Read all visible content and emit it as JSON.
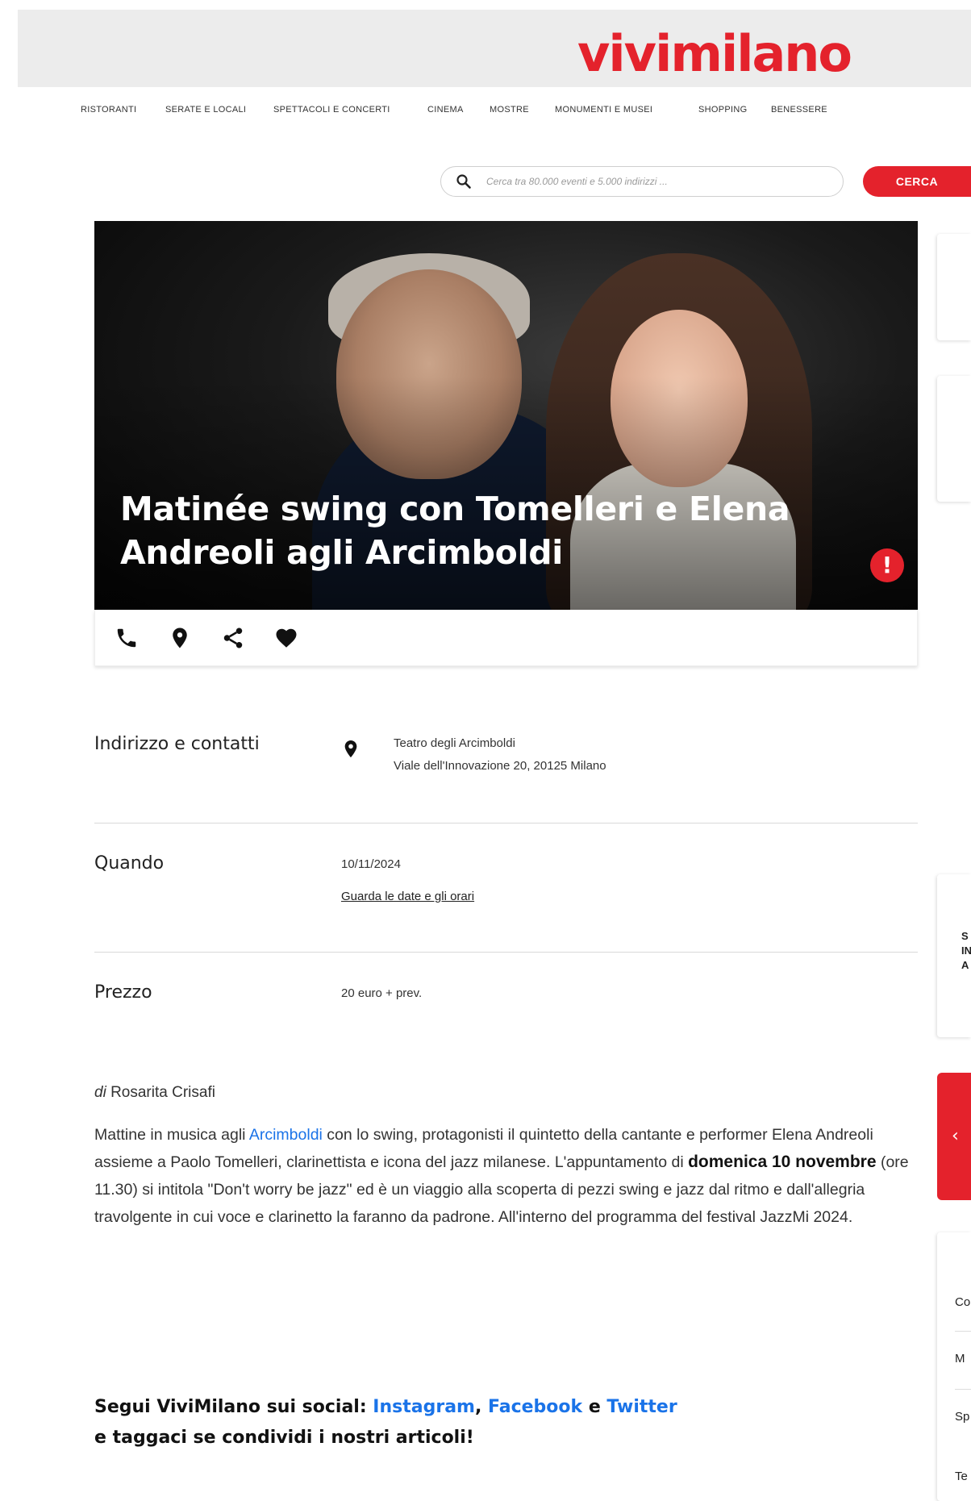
{
  "header": {
    "logo_text": "vivimilano",
    "brand_color": "#e4222c"
  },
  "nav": {
    "items": [
      "RISTORANTI",
      "SERATE E LOCALI",
      "SPETTACOLI E CONCERTI",
      "CINEMA",
      "MOSTRE",
      "MONUMENTI E MUSEI",
      "SHOPPING",
      "BENESSERE"
    ]
  },
  "search": {
    "placeholder": "Cerca tra 80.000 eventi e 5.000 indirizzi ...",
    "button_label": "CERCA"
  },
  "hero": {
    "title": "Matinée swing con Tomelleri e Elena Andreoli agli Arcimboldi",
    "alert_label": "!"
  },
  "actions": [
    "phone-icon",
    "map-pin-icon",
    "share-icon",
    "heart-icon"
  ],
  "info": {
    "address_label": "Indirizzo e contatti",
    "venue_name": "Teatro degli Arcimboldi",
    "venue_address": "Viale dell'Innovazione 20, 20125 Milano",
    "when_label": "Quando",
    "date": "10/11/2024",
    "dates_link": "Guarda le date e gli orari",
    "price_label": "Prezzo",
    "price": "20 euro + prev."
  },
  "article": {
    "author_prefix": "di",
    "author_name": "Rosarita Crisafi",
    "p1": "Mattine in musica agli ",
    "link_arcimboldi": "Arcimboldi",
    "p2": " con lo swing, protagonisti il quintetto della cantante e performer Elena Andreoli assieme a Paolo Tomelleri, clarinettista e icona del jazz milanese. L'appuntamento di ",
    "strong_date": "domenica 10 novembre",
    "p3": " (ore 11.30) si intitola \"Don't worry be jazz\" ed è un viaggio alla scoperta di pezzi swing e jazz dal ritmo e dall'allegria travolgente in cui voce e clarinetto la faranno da padrone. All'interno del programma del festival JazzMi 2024."
  },
  "social": {
    "lead": "Segui ViviMilano sui social: ",
    "instagram": "Instagram",
    "sep1": ", ",
    "facebook": "Facebook",
    "sep2": " e ",
    "twitter": "Twitter",
    "line2": "e taggaci se condividi i nostri articoli!"
  },
  "sidebar": {
    "card_letters": [
      "S",
      "IN",
      "A"
    ],
    "chevron": "‹",
    "list_items": [
      "Co",
      "M",
      "Sp",
      "Te"
    ]
  }
}
